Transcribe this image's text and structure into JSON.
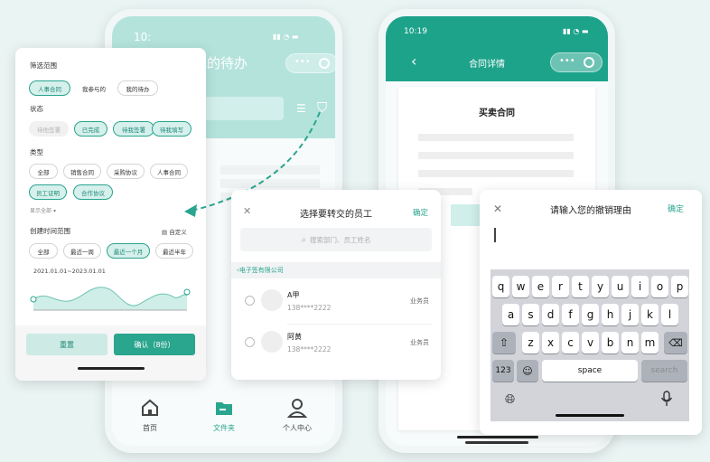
{
  "left_phone": {
    "time": "10:",
    "title": "我的待办",
    "nav": [
      {
        "label": "首页",
        "icon": "home-icon"
      },
      {
        "label": "文件夹",
        "icon": "folder-icon"
      },
      {
        "label": "个人中心",
        "icon": "person-icon"
      }
    ]
  },
  "filter": {
    "scope_title": "筛选范围",
    "scope_options": [
      "人事合同",
      "我参与的",
      "我的待办"
    ],
    "status_title": "状态",
    "status_options": [
      "待他签署",
      "已完成",
      "待我签署",
      "待我填写"
    ],
    "type_title": "类型",
    "type_options": [
      "全部",
      "销售合同",
      "采购协议",
      "人事合同",
      "员工证明",
      "合作协议"
    ],
    "show_all": "显示全部",
    "time_title": "创建时间范围",
    "custom": "自定义",
    "time_options": [
      "全部",
      "最近一周",
      "最近一个月",
      "最近半年"
    ],
    "range_text": "2021.01.01~2023.01.01",
    "reset": "重置",
    "confirm": "确认（8份）"
  },
  "transfer": {
    "title": "选择要转交的员工",
    "confirm": "确定",
    "search_placeholder": "搜索部门、员工姓名",
    "company": "电子签有限公司",
    "employees": [
      {
        "name": "A甲",
        "phone": "138****2222",
        "role": "业务员"
      },
      {
        "name": "阿黄",
        "phone": "138****2222",
        "role": "业务员"
      }
    ]
  },
  "right_phone": {
    "time": "10:19",
    "title": "合同详情",
    "doc_title": "买卖合同"
  },
  "revoke": {
    "title": "请输入您的撤销理由",
    "confirm": "确定",
    "keyboard": {
      "row1": [
        "q",
        "w",
        "e",
        "r",
        "t",
        "y",
        "u",
        "i",
        "o",
        "p"
      ],
      "row2": [
        "a",
        "s",
        "d",
        "f",
        "g",
        "h",
        "j",
        "k",
        "l"
      ],
      "row3": [
        "z",
        "x",
        "c",
        "v",
        "b",
        "n",
        "m"
      ],
      "num": "123",
      "space": "space",
      "search": "search"
    }
  },
  "colors": {
    "accent": "#2aa58e",
    "header_light": "#b4e3dc",
    "header_dark": "#1ea38b"
  }
}
